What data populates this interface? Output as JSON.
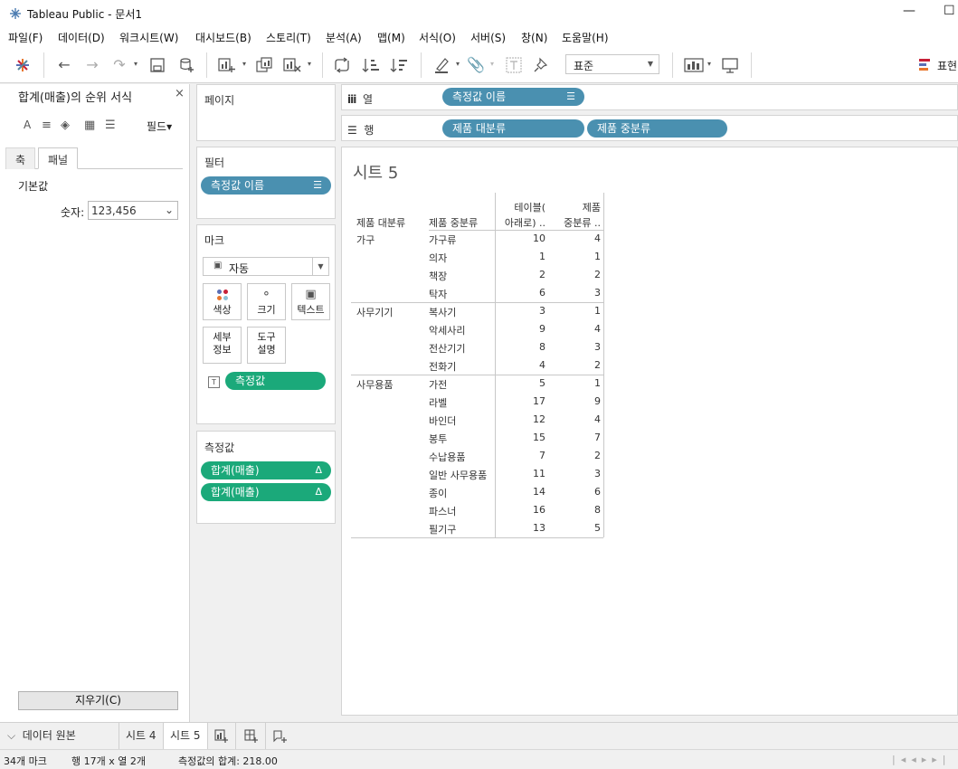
{
  "window": {
    "title": "Tableau Public - 문서1",
    "minimize_glyph": "—",
    "maximize_glyph": "☐"
  },
  "menu": [
    "파일(F)",
    "데이터(D)",
    "워크시트(W)",
    "대시보드(B)",
    "스토리(T)",
    "분석(A)",
    "맵(M)",
    "서식(O)",
    "서버(S)",
    "창(N)",
    "도움말(H)"
  ],
  "toolbar": {
    "icons": [
      "tableau-logo-icon",
      "back-icon",
      "forward-icon",
      "redo-icon",
      "save-icon",
      "new-datasource-icon",
      "new-worksheet-icon",
      "duplicate-icon",
      "clear-sheet-icon",
      "swap-icon",
      "sort-asc-icon",
      "sort-desc-icon",
      "highlight-icon",
      "group-icon",
      "label-icon",
      "pin-icon",
      "show-me-icon",
      "presentation-icon"
    ],
    "fit_value": "표준",
    "show_me_label": "표현"
  },
  "format_pane": {
    "title": "합계(매출)의 순위 서식",
    "close_glyph": "×",
    "field_button": "필드▾",
    "tabs": [
      "축",
      "패널"
    ],
    "active_tab": "패널",
    "section_default": "기본값",
    "number_label": "숫자:",
    "number_value": "123,456",
    "clear_button": "지우기(C)"
  },
  "cards": {
    "pages_title": "페이지",
    "filters_title": "필터",
    "filter_pill": "측정값 이름",
    "marks_title": "마크",
    "marks_type": "자동",
    "mark_buttons": [
      {
        "name": "color",
        "label": "색상"
      },
      {
        "name": "size",
        "label": "크기"
      },
      {
        "name": "text",
        "label": "텍스트"
      },
      {
        "name": "detail",
        "label1": "세부",
        "label2": "정보"
      },
      {
        "name": "tooltip",
        "label1": "도구",
        "label2": "설명"
      }
    ],
    "marks_text_pill": "측정값",
    "measure_values_title": "측정값",
    "measure_pills": [
      "합계(매출)",
      "합계(매출)"
    ],
    "measure_pill_glyph": "Δ"
  },
  "shelves": {
    "columns_label": "열",
    "columns_pills": [
      "측정값 이름"
    ],
    "rows_label": "행",
    "rows_pills": [
      "제품 대분류",
      "제품 중분류"
    ]
  },
  "sheet": {
    "title": "시트 5",
    "headers": {
      "col1": "제품 대분류",
      "col2": "제품 중분류",
      "m1_line1": "테이블(",
      "m1_line2": "아래로) ..",
      "m2_line1": "제품",
      "m2_line2": "중분류 .."
    },
    "groups": [
      {
        "name": "가구",
        "rows": [
          {
            "sub": "가구류",
            "m1": "10",
            "m2": "4"
          },
          {
            "sub": "의자",
            "m1": "1",
            "m2": "1"
          },
          {
            "sub": "책장",
            "m1": "2",
            "m2": "2"
          },
          {
            "sub": "탁자",
            "m1": "6",
            "m2": "3"
          }
        ]
      },
      {
        "name": "사무기기",
        "rows": [
          {
            "sub": "복사기",
            "m1": "3",
            "m2": "1"
          },
          {
            "sub": "악세사리",
            "m1": "9",
            "m2": "4"
          },
          {
            "sub": "전산기기",
            "m1": "8",
            "m2": "3"
          },
          {
            "sub": "전화기",
            "m1": "4",
            "m2": "2"
          }
        ]
      },
      {
        "name": "사무용품",
        "rows": [
          {
            "sub": "가전",
            "m1": "5",
            "m2": "1"
          },
          {
            "sub": "라벨",
            "m1": "17",
            "m2": "9"
          },
          {
            "sub": "바인더",
            "m1": "12",
            "m2": "4"
          },
          {
            "sub": "봉투",
            "m1": "15",
            "m2": "7"
          },
          {
            "sub": "수납용품",
            "m1": "7",
            "m2": "2"
          },
          {
            "sub": "일반 사무용품",
            "m1": "11",
            "m2": "3"
          },
          {
            "sub": "종이",
            "m1": "14",
            "m2": "6"
          },
          {
            "sub": "파스너",
            "m1": "16",
            "m2": "8"
          },
          {
            "sub": "필기구",
            "m1": "13",
            "m2": "5"
          }
        ]
      }
    ]
  },
  "tabs": {
    "datasource": "데이터 원본",
    "sheets": [
      "시트 4",
      "시트 5"
    ],
    "active_sheet": "시트 5"
  },
  "status": {
    "marks": "34개 마크",
    "rows_cols": "행 17개  x  열 2개",
    "sum": "측정값의 합계: 218.00"
  }
}
